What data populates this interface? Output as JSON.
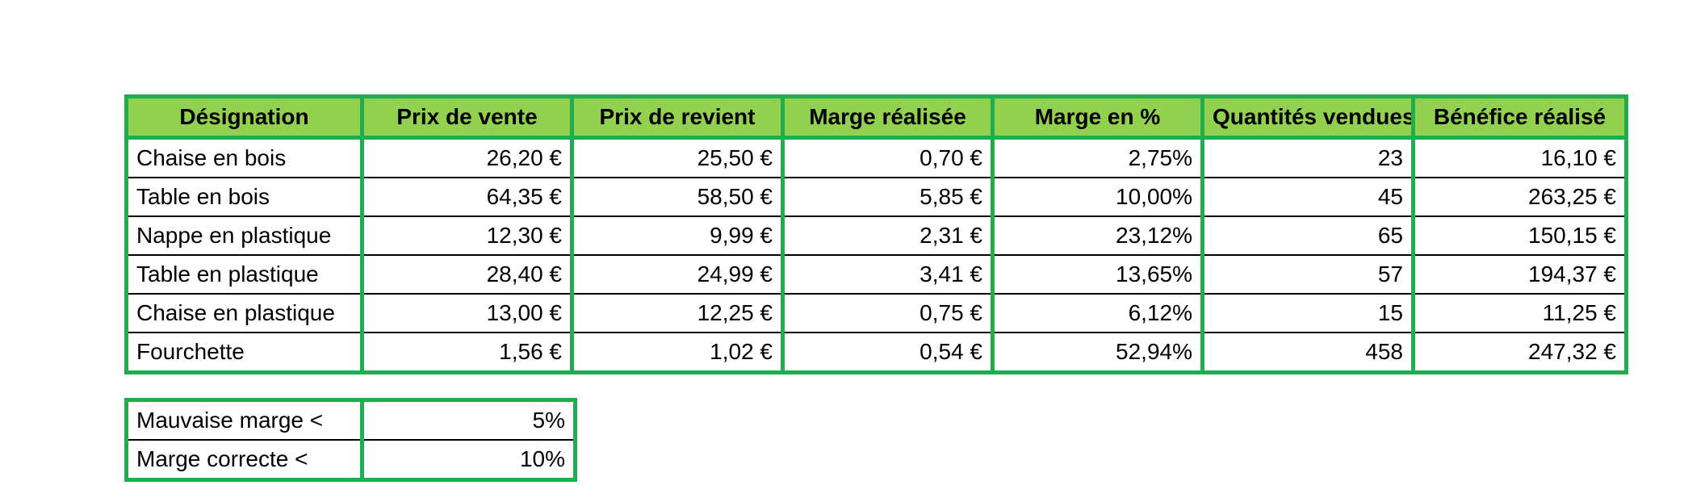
{
  "main_table": {
    "headers": [
      "Désignation",
      "Prix de vente",
      "Prix de revient",
      "Marge réalisée",
      "Marge en %",
      "Quantités vendues",
      "Bénéfice réalisé"
    ],
    "rows": [
      [
        "Chaise en bois",
        "26,20 €",
        "25,50 €",
        "0,70 €",
        "2,75%",
        "23",
        "16,10 €"
      ],
      [
        "Table en bois",
        "64,35 €",
        "58,50 €",
        "5,85 €",
        "10,00%",
        "45",
        "263,25 €"
      ],
      [
        "Nappe en plastique",
        "12,30 €",
        "9,99 €",
        "2,31 €",
        "23,12%",
        "65",
        "150,15 €"
      ],
      [
        "Table en plastique",
        "28,40 €",
        "24,99 €",
        "3,41 €",
        "13,65%",
        "57",
        "194,37 €"
      ],
      [
        "Chaise en plastique",
        "13,00 €",
        "12,25 €",
        "0,75 €",
        "6,12%",
        "15",
        "11,25 €"
      ],
      [
        "Fourchette",
        "1,56 €",
        "1,02 €",
        "0,54 €",
        "52,94%",
        "458",
        "247,32 €"
      ]
    ]
  },
  "thresholds": {
    "rows": [
      [
        "Mauvaise marge <",
        "5%"
      ],
      [
        "Marge correcte <",
        "10%"
      ]
    ]
  },
  "colors": {
    "header_fill": "#92d050",
    "border_green": "#1fad50"
  }
}
